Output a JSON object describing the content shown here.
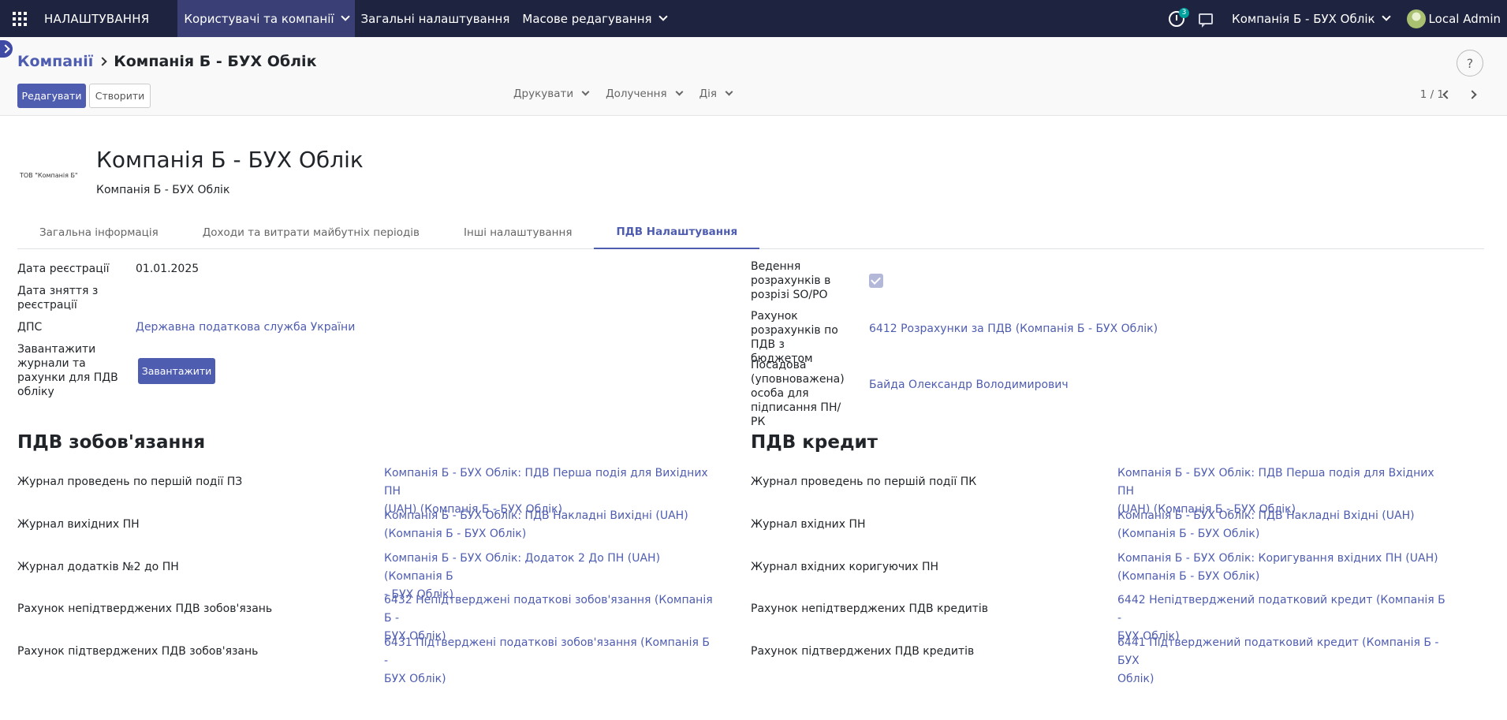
{
  "navbar": {
    "brand": "НАЛАШТУВАННЯ",
    "menu": [
      {
        "label": "Користувачі та компанії",
        "active": true,
        "dropdown": true
      },
      {
        "label": "Загальні налаштування",
        "active": false,
        "dropdown": false
      },
      {
        "label": "Масове редагування",
        "active": false,
        "dropdown": true
      }
    ],
    "activity_count": "3",
    "company": "Компанія Б - БУХ Облік",
    "user": "Local Admin"
  },
  "breadcrumb": {
    "parent": "Компанії",
    "current": "Компанія Б - БУХ Облік"
  },
  "control": {
    "edit_label": "Редагувати",
    "create_label": "Створити",
    "print_label": "Друкувати",
    "attach_label": "Долучення",
    "action_label": "Дія",
    "pager": "1 / 1",
    "help": "?"
  },
  "company": {
    "logo_text": "ТОВ \"Компанія Б\"",
    "name": "Компанія Б - БУХ Облік",
    "subtitle": "Компанія Б - БУХ Облік"
  },
  "tabs": [
    {
      "label": "Загальна інформація",
      "active": false
    },
    {
      "label": "Доходи та витрати майбутніх періодів",
      "active": false
    },
    {
      "label": "Інші налаштування",
      "active": false
    },
    {
      "label": "ПДВ Налаштування",
      "active": true
    }
  ],
  "left_fields": {
    "reg_date_label": "Дата реєстрації",
    "reg_date": "01.01.2025",
    "dereg_label": "Дата зняття з реєстрації",
    "dps_label": "ДПС",
    "dps": "Державна податкова служба України",
    "load_label": "Завантажити журнали та рахунки для ПДВ обліку",
    "load_button": "Завантажити"
  },
  "right_fields": {
    "sopo_label": "Ведення розрахунків в розрізі SO/PO",
    "sopo_checked": true,
    "account_label": "Рахунок розрахунків по ПДВ з бюджетом",
    "account": "6412 Розрахунки за ПДВ (Компанія Б - БУХ Облік)",
    "signer_label": "Посадова (уповноважена) особа для підписання ПН/РК",
    "signer": "Байда Олександр Володимирович"
  },
  "liabilities": {
    "title": "ПДВ зобов'язання",
    "rows": [
      {
        "label": "Журнал проведень по першій події ПЗ",
        "line1": "Компанія Б - БУХ Облік: ПДВ Перша подія для Вихідних ПН",
        "line2": "(UAH) (Компанія Б - БУХ Облік)"
      },
      {
        "label": "Журнал вихідних ПН",
        "line1": "Компанія Б - БУХ Облік: ПДВ Накладні Вихідні (UAH)",
        "line2": "(Компанія Б - БУХ Облік)"
      },
      {
        "label": "Журнал додатків №2 до ПН",
        "line1": "Компанія Б - БУХ Облік: Додаток 2 До ПН (UAH) (Компанія Б",
        "line2": "- БУХ Облік)"
      },
      {
        "label": "Рахунок непідтверджених ПДВ зобов'язань",
        "line1": "6432 Непідтверджені податкові зобов'язання (Компанія Б -",
        "line2": "БУХ Облік)"
      },
      {
        "label": "Рахунок підтверджених ПДВ зобов'язань",
        "line1": "6431 Підтверджені податкові зобов'язання (Компанія Б -",
        "line2": "БУХ Облік)"
      }
    ]
  },
  "credit": {
    "title": "ПДВ кредит",
    "rows": [
      {
        "label": "Журнал проведень по першій події ПК",
        "line1": "Компанія Б - БУХ Облік: ПДВ Перша подія для Вхідних ПН",
        "line2": "(UAH) (Компанія Б - БУХ Облік)"
      },
      {
        "label": "Журнал вхідних ПН",
        "line1": "Компанія Б - БУХ Облік: ПДВ Накладні Вхідні (UAH)",
        "line2": "(Компанія Б - БУХ Облік)"
      },
      {
        "label": "Журнал вхідних коригуючих ПН",
        "line1": "Компанія Б - БУХ Облік: Коригування вхідних ПН (UAH)",
        "line2": "(Компанія Б - БУХ Облік)"
      },
      {
        "label": "Рахунок непідтверджених ПДВ кредитів",
        "line1": "6442 Непідтверджений податковий кредит (Компанія Б -",
        "line2": "БУХ Облік)"
      },
      {
        "label": "Рахунок підтверджених ПДВ кредитів",
        "line1": "6441 Підтверджений податковий кредит (Компанія Б - БУХ",
        "line2": "Облік)"
      }
    ]
  },
  "colors": {
    "navbar": "#1e2340",
    "accent": "#4f5db0"
  }
}
